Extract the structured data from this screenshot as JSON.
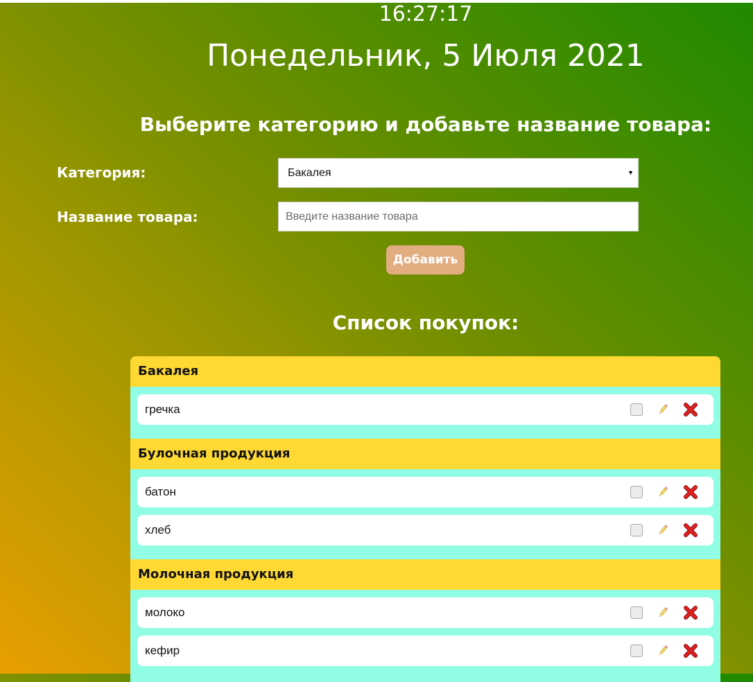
{
  "clock": "16:27:17",
  "date": "Понедельник, 5 Июля 2021",
  "form": {
    "heading": "Выберите категорию и добавьте название товара:",
    "category_label": "Категория:",
    "category_selected": "Бакалея",
    "name_label": "Название товара:",
    "name_placeholder": "Введите название товара",
    "add_button": "Добавить"
  },
  "list_title": "Список покупок:",
  "categories": [
    {
      "name": "Бакалея",
      "items": [
        "гречка"
      ]
    },
    {
      "name": "Булочная продукция",
      "items": [
        "батон",
        "хлеб"
      ]
    },
    {
      "name": "Молочная продукция",
      "items": [
        "молоко",
        "кефир"
      ]
    }
  ],
  "icons": {
    "check": "checkbox-icon",
    "edit": "pencil-icon",
    "delete": "close-icon"
  },
  "colors": {
    "category_header": "#fed833",
    "list_background": "#92fde5",
    "add_button": "#e3ad82",
    "delete_icon": "#d11b1b"
  }
}
